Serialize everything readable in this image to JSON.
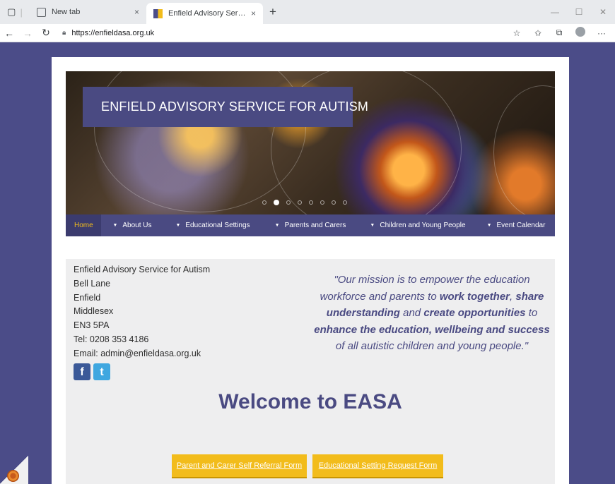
{
  "browser": {
    "tabs": [
      {
        "title": "New tab",
        "close": "×"
      },
      {
        "title": "Enfield Advisory Service for Autism",
        "close": "×"
      }
    ],
    "new_tab": "+",
    "url": "https://enfieldasa.org.uk"
  },
  "site": {
    "banner_title": "ENFIELD ADVISORY SERVICE FOR AUTISM",
    "slide_count": 8,
    "active_slide": 2,
    "nav": [
      {
        "label": "Home",
        "active": true
      },
      {
        "label": "About Us"
      },
      {
        "label": "Educational Settings"
      },
      {
        "label": "Parents and Carers"
      },
      {
        "label": "Children and Young People"
      },
      {
        "label": "Event Calendar"
      }
    ],
    "address": {
      "name": "Enfield Advisory Service for Autism",
      "line1": "Bell Lane",
      "line2": "Enfield",
      "line3": "Middlesex",
      "postcode": "EN3 5PA",
      "tel": "Tel: 0208 353 4186",
      "email": "Email: admin@enfieldasa.org.uk"
    },
    "mission": {
      "p1": "\"Our mission is to empower the education workforce and parents to ",
      "b1": "work together",
      "p2": ", ",
      "b2": "share understanding",
      "p3": " and ",
      "b3": "create opportunities",
      "p4": " to ",
      "b4": "enhance the education, wellbeing and success",
      "p5": " of all autistic children and young people.\""
    },
    "welcome": "Welcome to EASA",
    "buttons": {
      "parent_referral": "Parent and Carer Self Referral Form",
      "setting_request": "Educational Setting Request Form"
    }
  },
  "colors": {
    "brand_purple": "#4a4a82",
    "brand_yellow": "#f2bc1b"
  }
}
